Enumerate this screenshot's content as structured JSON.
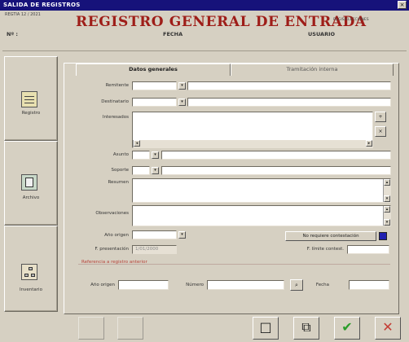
{
  "window": {
    "title": "SALIDA DE REGISTROS",
    "close": "×"
  },
  "header": {
    "code": "REGTIA 12 / 2021",
    "big_title": "REGISTRO GENERAL DE ENTRADA",
    "right_small": "REGIS/ELECCIONES",
    "nr_label": "Nº :",
    "fecha_label": "FECHA",
    "usuario_label": "USUARIO"
  },
  "sidebar": [
    {
      "label": "Registro",
      "icon": "register-icon"
    },
    {
      "label": "Archivo",
      "icon": "archive-icon"
    },
    {
      "label": "Inventario",
      "icon": "tree-icon"
    }
  ],
  "tabs": [
    {
      "label": "Datos generales"
    },
    {
      "label": "Tramitación interna"
    }
  ],
  "form": {
    "remitente": "Remitente",
    "destinatario": "Destinatario",
    "interesados": "Interesados",
    "asunto": "Asunto",
    "soporte": "Soporte",
    "resumen": "Resumen",
    "observaciones": "Observaciones",
    "ano_origen": "Año origen",
    "no_requiere": "No requiere contestación",
    "f_presentacion": "F. presentación",
    "f_presentacion_value": "1/01/2000",
    "f_limite": "F. límite contest.",
    "referencia": "Referencia a registro anterior",
    "ano_label": "Año origen",
    "numero_label": "Número",
    "fecha_label": "Fecha"
  },
  "bottom_buttons": [
    {
      "label": "",
      "icon": "blank-icon"
    },
    {
      "label": "",
      "icon": "copy-icon"
    },
    {
      "label": "□",
      "icon": "new-window-icon"
    },
    {
      "label": "⧉",
      "icon": "duplicate-icon"
    },
    {
      "label": "✔",
      "icon": "check-icon"
    },
    {
      "label": "✕",
      "icon": "cancel-icon"
    }
  ],
  "colors": {
    "title_bar": "#16127a",
    "accent_red": "#9e1d18",
    "check_green": "#2a9d2a",
    "cancel_red": "#c43c34",
    "checkbox_blue": "#2020b0"
  }
}
